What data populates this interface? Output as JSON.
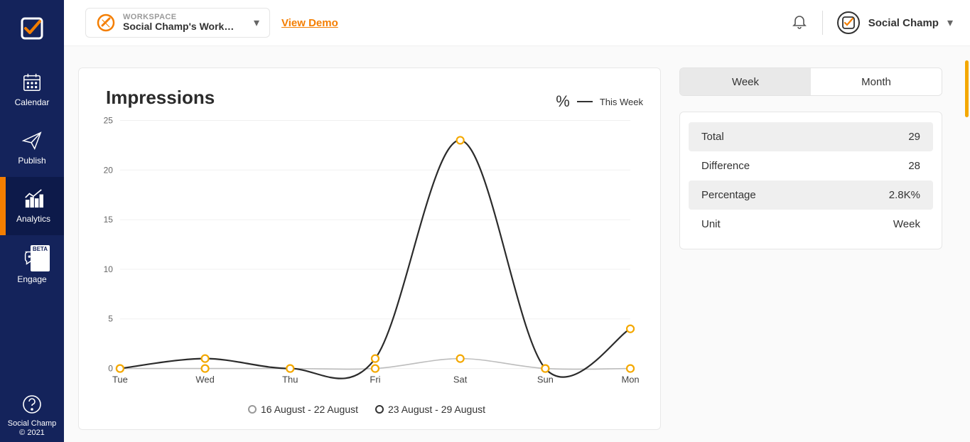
{
  "sidebar": {
    "items": [
      {
        "label": "Calendar"
      },
      {
        "label": "Publish"
      },
      {
        "label": "Analytics"
      },
      {
        "label": "Engage",
        "badge": "BETA"
      }
    ],
    "footer_line1": "Social Champ",
    "footer_line2": "© 2021"
  },
  "topbar": {
    "workspace_label": "WORKSPACE",
    "workspace_name": "Social Champ's Worksp…",
    "view_demo": "View Demo",
    "user_name": "Social Champ"
  },
  "chart": {
    "title": "Impressions",
    "legend_top_prefix": "%",
    "legend_top_label": "This Week",
    "legend_prev": "16 August - 22 August",
    "legend_curr": "23 August - 29 August"
  },
  "chart_data": {
    "type": "line",
    "categories": [
      "Tue",
      "Wed",
      "Thu",
      "Fri",
      "Sat",
      "Sun",
      "Mon"
    ],
    "series": [
      {
        "name": "16 August - 22 August",
        "values": [
          0,
          0,
          0,
          0,
          1,
          0,
          0
        ],
        "color": "#bdbdbd"
      },
      {
        "name": "23 August - 29 August",
        "values": [
          0,
          1,
          0,
          1,
          23,
          0,
          4
        ],
        "color": "#2b2b2b"
      }
    ],
    "title": "Impressions",
    "xlabel": "",
    "ylabel": "",
    "ylim": [
      0,
      25
    ],
    "yticks": [
      0,
      5,
      10,
      15,
      20,
      25
    ]
  },
  "segmented": {
    "week": "Week",
    "month": "Month"
  },
  "stats": {
    "rows": [
      {
        "label": "Total",
        "value": "29",
        "shaded": true
      },
      {
        "label": "Difference",
        "value": "28",
        "shaded": false
      },
      {
        "label": "Percentage",
        "value": "2.8K%",
        "shaded": true
      },
      {
        "label": "Unit",
        "value": "Week",
        "shaded": false
      }
    ]
  }
}
